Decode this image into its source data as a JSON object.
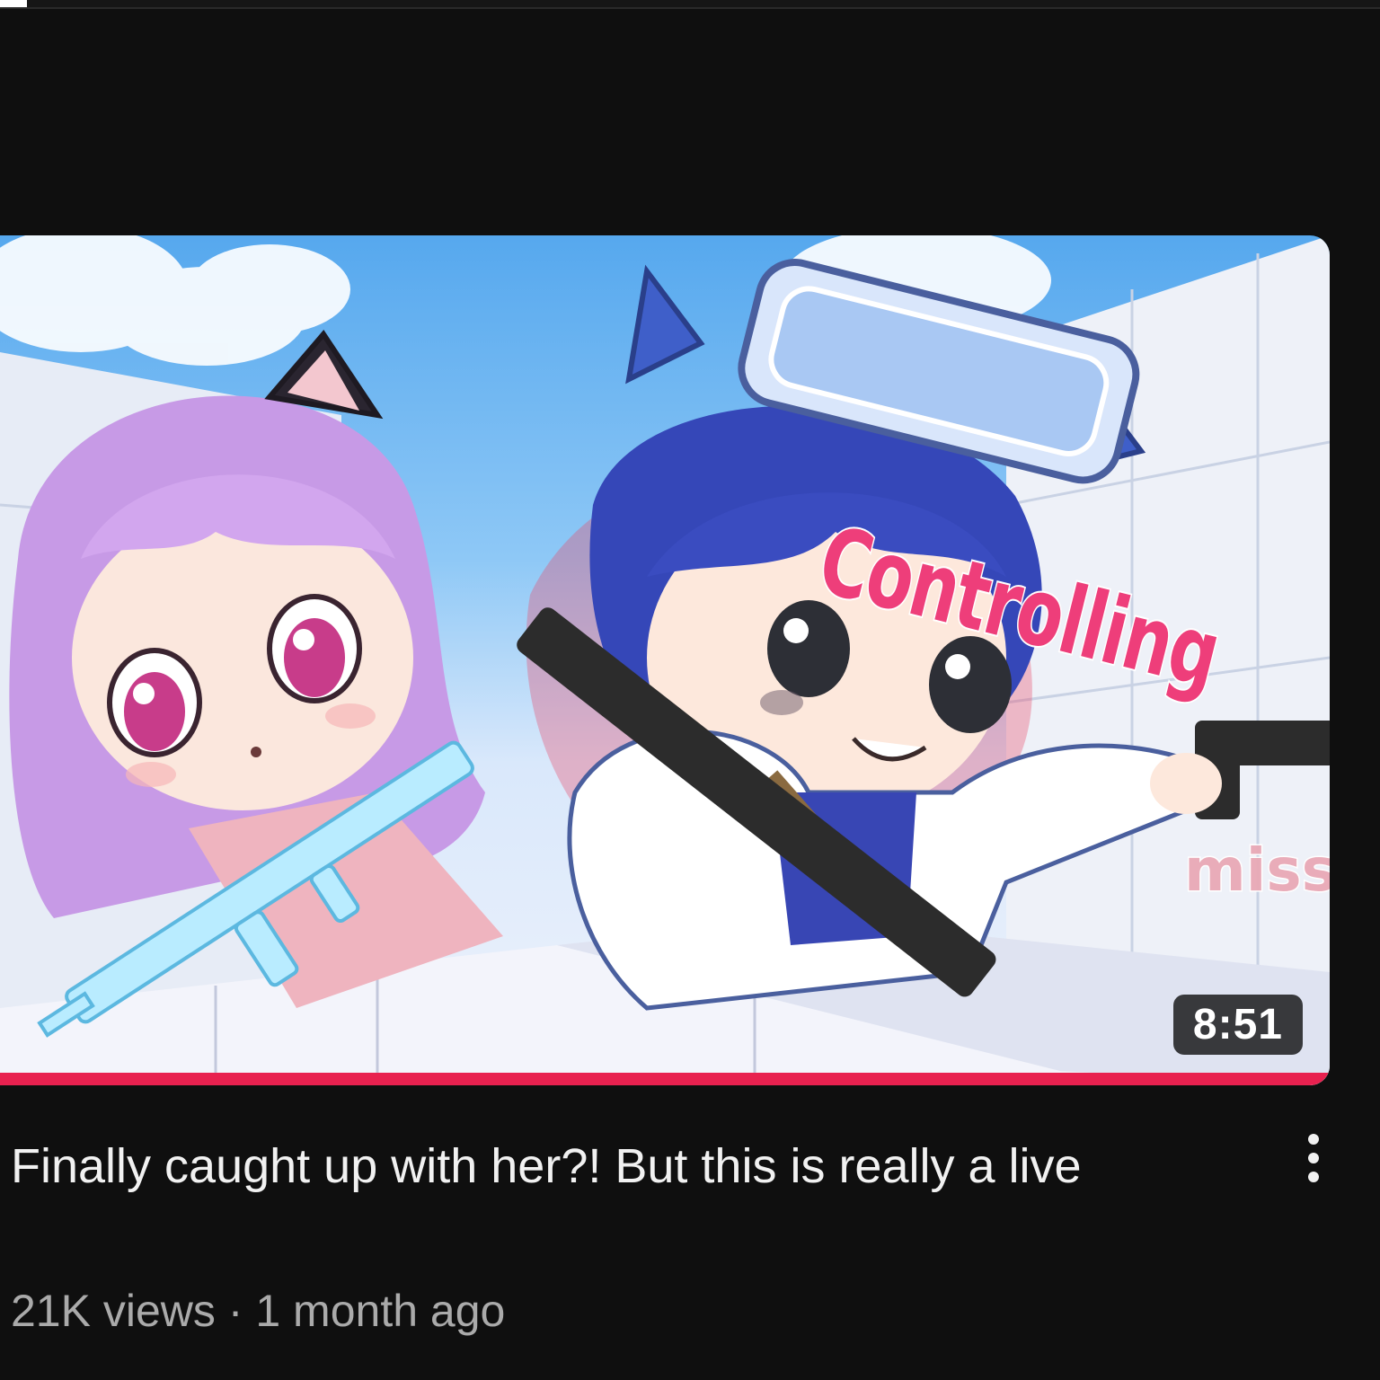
{
  "video": {
    "thumbnail_overlay_text": [
      "Controlling",
      "miss",
      "miss"
    ],
    "duration": "8:51",
    "progress_fraction": 1.0,
    "title": "Finally caught up with her?! But this is really a live",
    "views": "21K views",
    "separator": "·",
    "age": "1 month ago",
    "more_icon": "vertical-ellipsis-icon"
  },
  "colors": {
    "background": "#0f0f0f",
    "progress": "#e8214f",
    "title": "#f1f1f1",
    "meta": "#aaaaaa"
  }
}
